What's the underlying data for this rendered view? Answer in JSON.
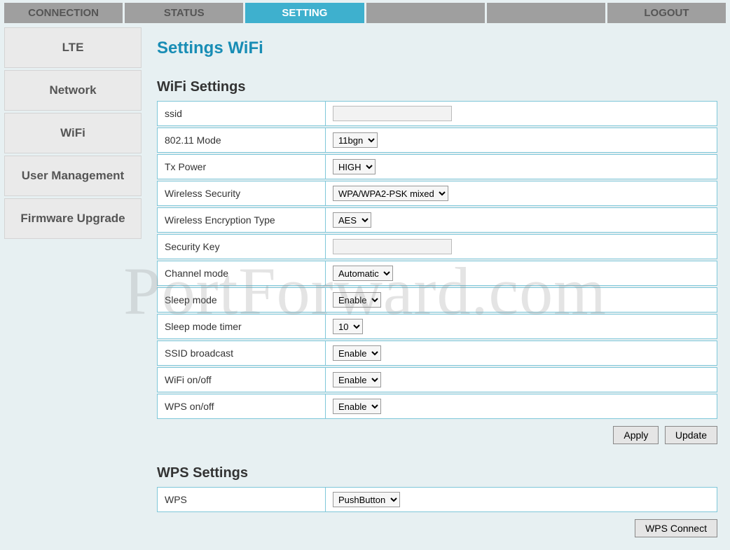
{
  "topnav": {
    "items": [
      {
        "label": "CONNECTION"
      },
      {
        "label": "STATUS"
      },
      {
        "label": "SETTING"
      },
      {
        "label": ""
      },
      {
        "label": ""
      },
      {
        "label": "LOGOUT"
      }
    ],
    "active_index": 2
  },
  "sidebar": {
    "items": [
      {
        "label": "LTE"
      },
      {
        "label": "Network"
      },
      {
        "label": "WiFi"
      },
      {
        "label": "User Management"
      },
      {
        "label": "Firmware Upgrade"
      }
    ]
  },
  "page": {
    "title": "Settings WiFi",
    "wifi_section_title": "WiFi Settings",
    "wps_section_title": "WPS Settings",
    "buttons": {
      "apply": "Apply",
      "update": "Update",
      "wps_connect": "WPS Connect"
    }
  },
  "wifi_settings": {
    "rows": [
      {
        "label": "ssid",
        "type": "input",
        "value": ""
      },
      {
        "label": "802.11 Mode",
        "type": "select",
        "value": "11bgn"
      },
      {
        "label": "Tx Power",
        "type": "select",
        "value": "HIGH"
      },
      {
        "label": "Wireless Security",
        "type": "select",
        "value": "WPA/WPA2-PSK mixed"
      },
      {
        "label": "Wireless Encryption Type",
        "type": "select",
        "value": "AES"
      },
      {
        "label": "Security Key",
        "type": "input",
        "value": ""
      },
      {
        "label": "Channel mode",
        "type": "select",
        "value": "Automatic"
      },
      {
        "label": "Sleep mode",
        "type": "select",
        "value": "Enable"
      },
      {
        "label": "Sleep mode timer",
        "type": "select",
        "value": "10"
      },
      {
        "label": "SSID broadcast",
        "type": "select",
        "value": "Enable"
      },
      {
        "label": "WiFi on/off",
        "type": "select",
        "value": "Enable"
      },
      {
        "label": "WPS on/off",
        "type": "select",
        "value": "Enable"
      }
    ]
  },
  "wps_settings": {
    "rows": [
      {
        "label": "WPS",
        "type": "select",
        "value": "PushButton"
      }
    ]
  },
  "watermark": "PortForward.com"
}
